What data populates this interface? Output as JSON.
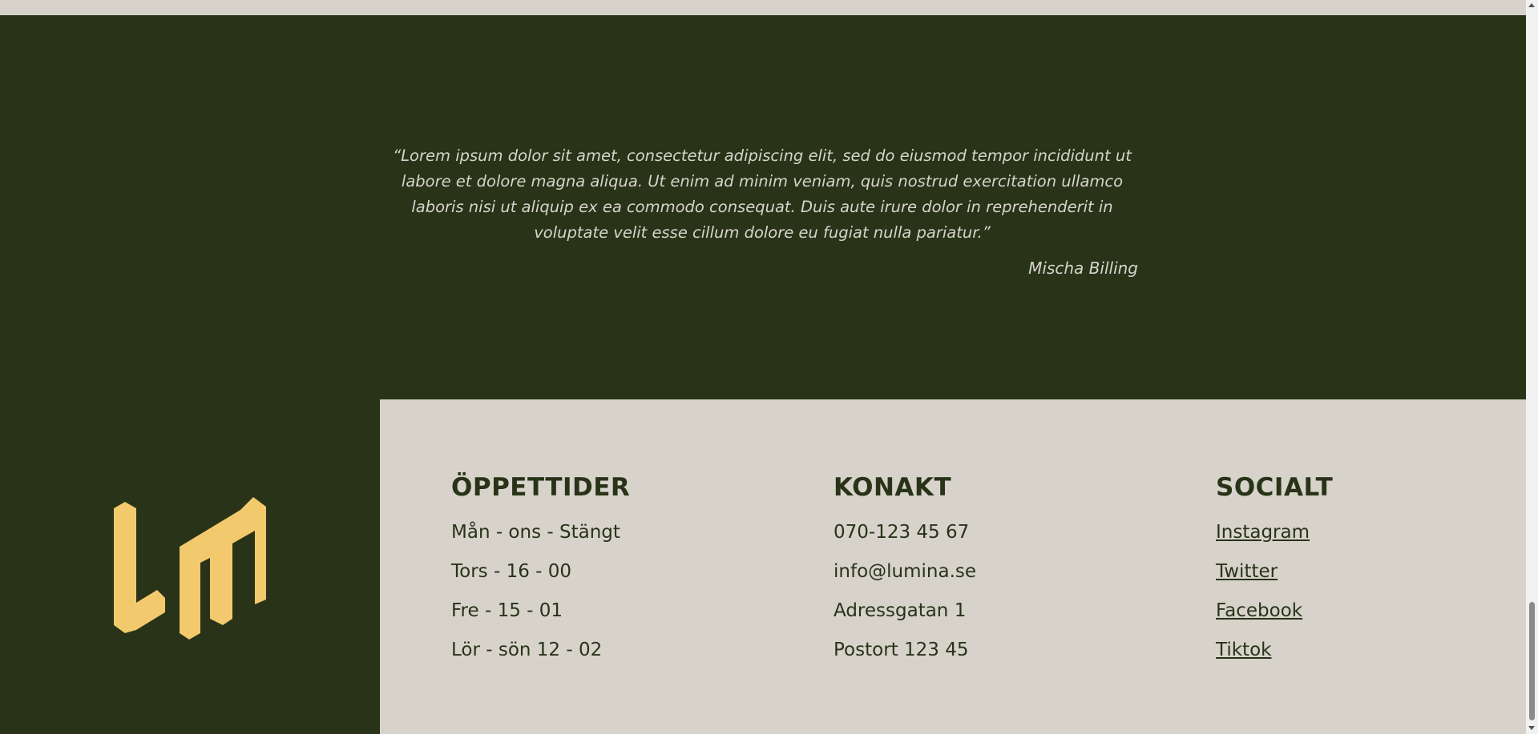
{
  "testimonial": {
    "quote": "“Lorem ipsum dolor sit amet, consectetur adipiscing elit, sed do eiusmod tempor incididunt ut labore et dolore magna aliqua. Ut enim ad minim veniam, quis nostrud exercitation ullamco laboris nisi ut aliquip ex ea commodo consequat. Duis aute irure dolor in reprehenderit in voluptate velit esse cillum dolore eu fugiat nulla pariatur.”",
    "author": "Mischa Billing"
  },
  "footer": {
    "hours": {
      "title": "ÖPPETTIDER",
      "items": [
        "Mån - ons - Stängt",
        "Tors - 16 - 00",
        "Fre - 15 - 01",
        "Lör - sön 12 - 02"
      ]
    },
    "contact": {
      "title": "KONAKT",
      "items": [
        "070-123 45 67",
        "info@lumina.se",
        "Adressgatan 1",
        "Postort 123 45"
      ]
    },
    "social": {
      "title": "SOCIALT",
      "links": [
        "Instagram",
        "Twitter",
        "Facebook",
        "Tiktok"
      ]
    }
  },
  "logo": {
    "icon": "lm-logo-icon",
    "color": "#f2c96d"
  },
  "colors": {
    "dark_green": "#283318",
    "beige": "#d7d3cb",
    "accent": "#f2c96d"
  }
}
